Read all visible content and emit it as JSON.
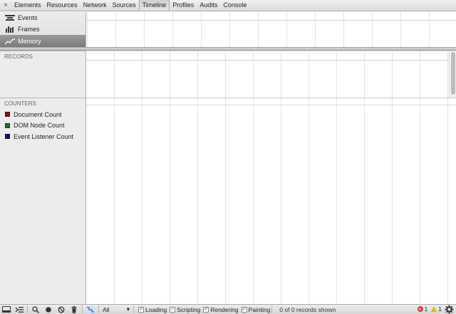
{
  "toolbar": {
    "close_glyph": "×",
    "tabs": [
      {
        "label": "Elements"
      },
      {
        "label": "Resources"
      },
      {
        "label": "Network"
      },
      {
        "label": "Sources"
      },
      {
        "label": "Timeline",
        "active": true
      },
      {
        "label": "Profiles"
      },
      {
        "label": "Audits"
      },
      {
        "label": "Console"
      }
    ]
  },
  "sidebar": {
    "overview_items": [
      {
        "label": "Events",
        "icon": "events-icon"
      },
      {
        "label": "Frames",
        "icon": "frames-icon"
      },
      {
        "label": "Memory",
        "icon": "memory-icon",
        "selected": true
      }
    ],
    "records_title": "RECORDS",
    "counters_title": "COUNTERS",
    "counters": [
      {
        "label": "Document Count",
        "color": "#7a1616"
      },
      {
        "label": "DOM Node Count",
        "color": "#1e6e1e"
      },
      {
        "label": "Event Listener Count",
        "color": "#14146e"
      }
    ]
  },
  "statusbar": {
    "filter_value": "All",
    "checkboxes": [
      {
        "label": "Loading",
        "checked": true,
        "color": "#3b73d1"
      },
      {
        "label": "Scripting",
        "checked": true,
        "color": "#d8a81c"
      },
      {
        "label": "Rendering",
        "checked": true,
        "color": "#7f3fbf"
      },
      {
        "label": "Painting",
        "checked": true,
        "color": "#3aa33a"
      }
    ],
    "records_shown": "0 of 0 records shown",
    "error_count": "1",
    "warning_count": "1"
  }
}
